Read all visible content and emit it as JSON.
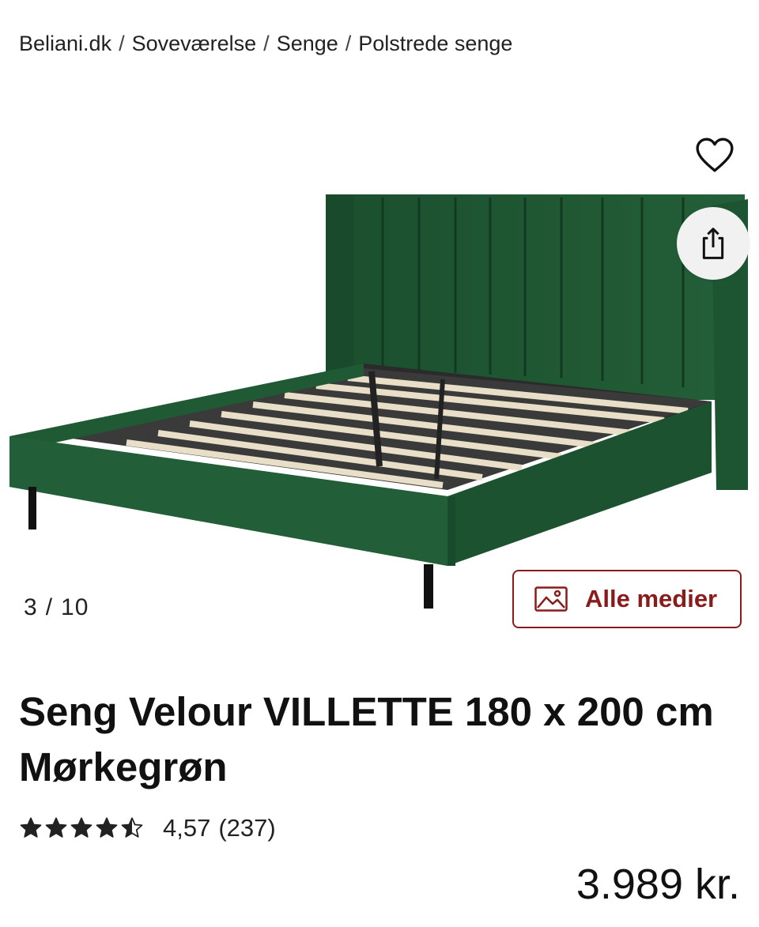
{
  "breadcrumb": [
    {
      "label": "Beliani.dk"
    },
    {
      "label": "Soveværelse"
    },
    {
      "label": "Senge"
    },
    {
      "label": "Polstrede senge"
    }
  ],
  "breadcrumb_separator": "/",
  "gallery": {
    "current": "3",
    "separator": "/",
    "total": "10",
    "all_media_label": "Alle medier"
  },
  "product": {
    "title": "Seng Velour VILLETTE 180 x 200 cm Mørkegrøn",
    "rating_value": 4.57,
    "rating_text": "4,57",
    "review_count": "(237)",
    "price": "3.989 kr."
  },
  "icons": {
    "favorite": "heart-icon",
    "share": "share-icon",
    "media": "image-icon",
    "star": "star-icon"
  },
  "colors": {
    "accent": "#8b1a1a",
    "velvet_green": "#1f5a34",
    "text": "#111111"
  }
}
